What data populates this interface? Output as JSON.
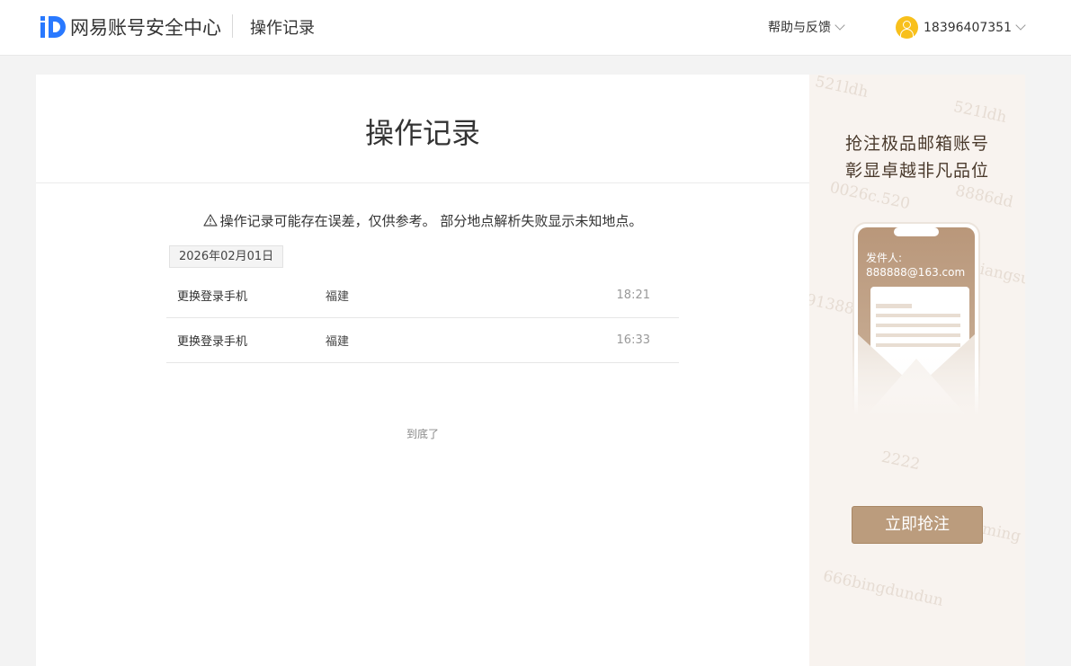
{
  "header": {
    "logo_text": "网易账号安全中心",
    "page_name": "操作记录",
    "help_label": "帮助与反馈",
    "username": "18396407351"
  },
  "main": {
    "title": "操作记录",
    "notice": "操作记录可能存在误差，仅供参考。 部分地点解析失败显示未知地点。",
    "date": "2026年02月01日",
    "records": [
      {
        "action": "更换登录手机",
        "place": "福建",
        "time": "18:21"
      },
      {
        "action": "更换登录手机",
        "place": "福建",
        "time": "16:33"
      }
    ],
    "end_text": "到底了"
  },
  "ad": {
    "line1": "抢注极品邮箱账号",
    "line2": "彰显卓越非凡品位",
    "sender_label": "发件人:",
    "sender_email": "888888@163.com",
    "button": "立即抢注",
    "watermarks": [
      "521ldh",
      "8886dd",
      "0026c.520",
      "91388",
      "2222",
      "666bingdundun",
      "jiangsu",
      "ming"
    ]
  },
  "colors": {
    "brand_blue": "#2979ff",
    "avatar_yellow": "#f8c01c",
    "ad_button": "#bb9c7d",
    "ad_bg": "#f8f3ef"
  }
}
